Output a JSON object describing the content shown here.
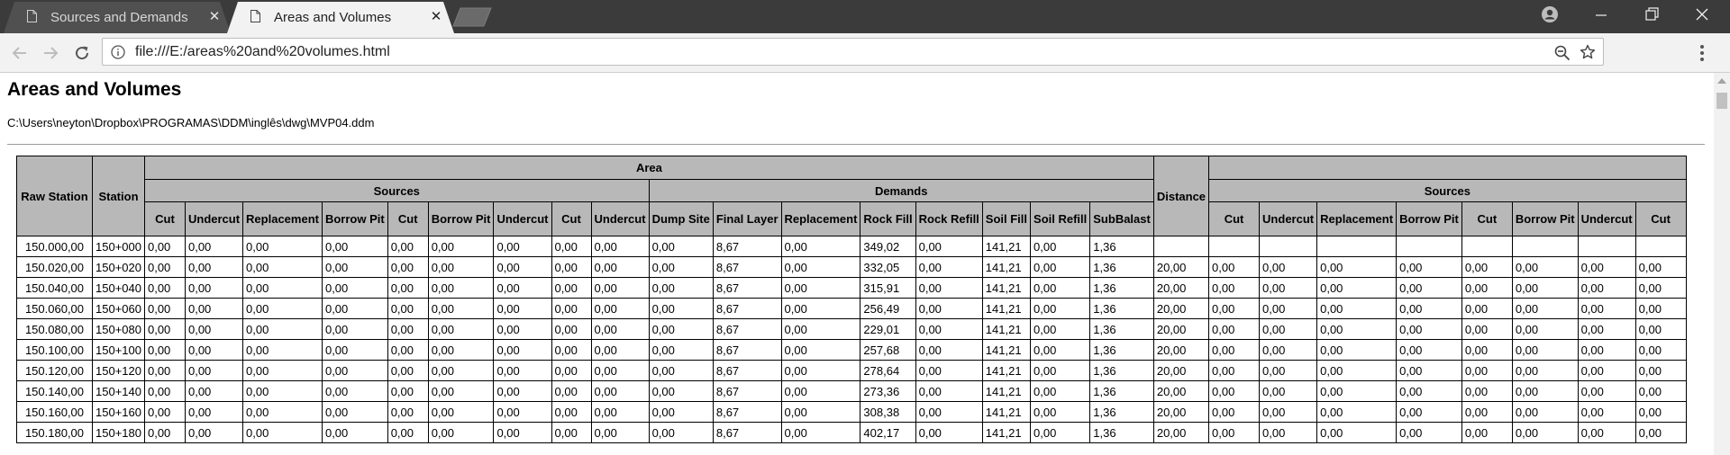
{
  "browser": {
    "tabs": [
      {
        "title": "Sources and Demands",
        "active": false
      },
      {
        "title": "Areas and Volumes",
        "active": true
      }
    ],
    "url": "file:///E:/areas%20and%20volumes.html"
  },
  "page": {
    "title": "Areas and Volumes",
    "file_path": "C:\\Users\\neyton\\Dropbox\\PROGRAMAS\\DDM\\inglês\\dwg\\MVP04.ddm"
  },
  "table": {
    "group_headers": {
      "raw_station": "Raw Station",
      "station": "Station",
      "area": "Area",
      "sources": "Sources",
      "demands": "Demands",
      "distance": "Distance",
      "sources_2": "Sources"
    },
    "area_columns": [
      "Cut",
      "Undercut",
      "Replacement",
      "Borrow Pit",
      "Cut",
      "Borrow Pit",
      "Undercut",
      "Cut",
      "Undercut",
      "Dump Site",
      "Final Layer",
      "Replacement",
      "Rock Fill",
      "Rock Refill",
      "Soil Fill",
      "Soil Refill",
      "SubBalast"
    ],
    "right_columns": [
      "Cut",
      "Undercut",
      "Replacement",
      "Borrow Pit",
      "Cut",
      "Borrow Pit",
      "Undercut",
      "Cut"
    ],
    "rows": [
      {
        "raw": "150.000,00",
        "station": "150+000",
        "rock_fill": "349,02",
        "distance": "",
        "right": [
          "",
          "",
          "",
          "",
          "",
          "",
          "",
          ""
        ]
      },
      {
        "raw": "150.020,00",
        "station": "150+020",
        "rock_fill": "332,05",
        "distance": "20,00",
        "right": [
          "0,00",
          "0,00",
          "0,00",
          "0,00",
          "0,00",
          "0,00",
          "0,00",
          "0,00"
        ]
      },
      {
        "raw": "150.040,00",
        "station": "150+040",
        "rock_fill": "315,91",
        "distance": "20,00",
        "right": [
          "0,00",
          "0,00",
          "0,00",
          "0,00",
          "0,00",
          "0,00",
          "0,00",
          "0,00"
        ]
      },
      {
        "raw": "150.060,00",
        "station": "150+060",
        "rock_fill": "256,49",
        "distance": "20,00",
        "right": [
          "0,00",
          "0,00",
          "0,00",
          "0,00",
          "0,00",
          "0,00",
          "0,00",
          "0,00"
        ]
      },
      {
        "raw": "150.080,00",
        "station": "150+080",
        "rock_fill": "229,01",
        "distance": "20,00",
        "right": [
          "0,00",
          "0,00",
          "0,00",
          "0,00",
          "0,00",
          "0,00",
          "0,00",
          "0,00"
        ]
      },
      {
        "raw": "150.100,00",
        "station": "150+100",
        "rock_fill": "257,68",
        "distance": "20,00",
        "right": [
          "0,00",
          "0,00",
          "0,00",
          "0,00",
          "0,00",
          "0,00",
          "0,00",
          "0,00"
        ]
      },
      {
        "raw": "150.120,00",
        "station": "150+120",
        "rock_fill": "278,64",
        "distance": "20,00",
        "right": [
          "0,00",
          "0,00",
          "0,00",
          "0,00",
          "0,00",
          "0,00",
          "0,00",
          "0,00"
        ]
      },
      {
        "raw": "150.140,00",
        "station": "150+140",
        "rock_fill": "273,36",
        "distance": "20,00",
        "right": [
          "0,00",
          "0,00",
          "0,00",
          "0,00",
          "0,00",
          "0,00",
          "0,00",
          "0,00"
        ]
      },
      {
        "raw": "150.160,00",
        "station": "150+160",
        "rock_fill": "308,38",
        "distance": "20,00",
        "right": [
          "0,00",
          "0,00",
          "0,00",
          "0,00",
          "0,00",
          "0,00",
          "0,00",
          "0,00"
        ]
      },
      {
        "raw": "150.180,00",
        "station": "150+180",
        "rock_fill": "402,17",
        "distance": "20,00",
        "right": [
          "0,00",
          "0,00",
          "0,00",
          "0,00",
          "0,00",
          "0,00",
          "0,00",
          "0,00"
        ]
      }
    ],
    "constant_values": {
      "zero": "0,00",
      "final_layer": "8,67",
      "soil_fill": "141,21",
      "subbalast": "1,36"
    }
  }
}
